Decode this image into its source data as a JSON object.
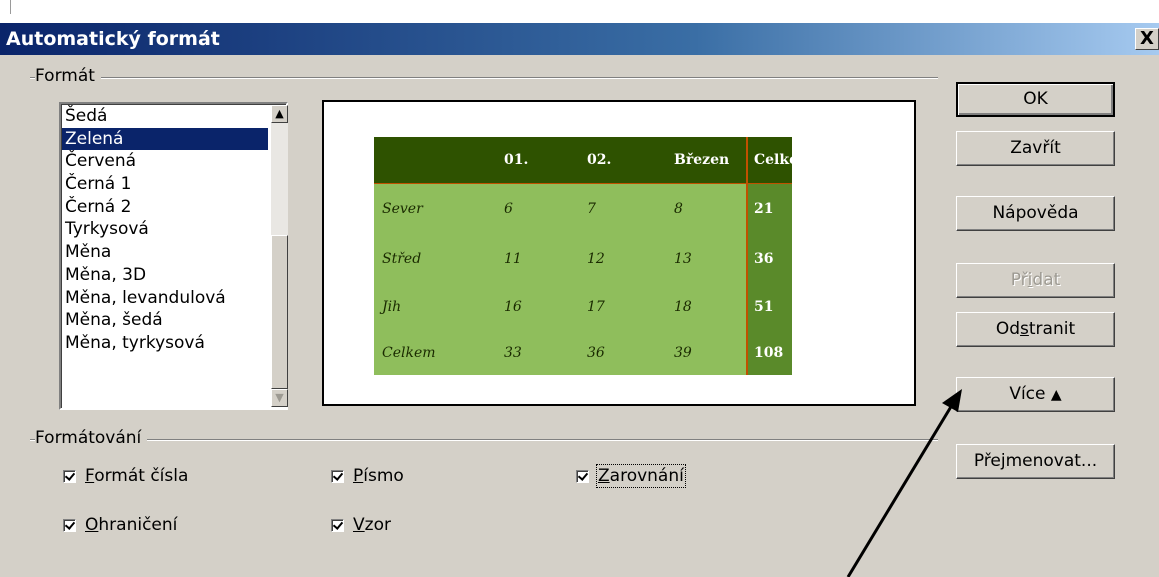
{
  "dialog": {
    "title": "Automatický formát",
    "close_glyph": "X"
  },
  "format_group": {
    "label": "Formát",
    "items": [
      "Šedá",
      "Zelená",
      "Červená",
      "Černá 1",
      "Černá 2",
      "Tyrkysová",
      "Měna",
      "Měna, 3D",
      "Měna, levandulová",
      "Měna, šedá",
      "Měna, tyrkysová"
    ],
    "selected_index": 1
  },
  "preview": {
    "header": [
      "",
      "01.",
      "02.",
      "Březen",
      "Celkem"
    ],
    "rows": [
      [
        "Sever",
        "6",
        "7",
        "8",
        "21"
      ],
      [
        "Střed",
        "11",
        "12",
        "13",
        "36"
      ],
      [
        "Jih",
        "16",
        "17",
        "18",
        "51"
      ],
      [
        "Celkem",
        "33",
        "36",
        "39",
        "108"
      ]
    ],
    "colors": {
      "header_bg": "#2e5200",
      "body_bg": "#8fbe5c",
      "total_col_bg": "#5a8a2a",
      "separator": "#c05000"
    }
  },
  "formatting_group": {
    "label": "Formátování",
    "options": {
      "number_format": {
        "label": "Formát čísla",
        "checked": true
      },
      "font": {
        "label": "Písmo",
        "checked": true
      },
      "alignment": {
        "label": "Zarovnání",
        "checked": true
      },
      "borders": {
        "label": "Ohraničení",
        "checked": true
      },
      "pattern": {
        "label": "Vzor",
        "checked": true
      }
    }
  },
  "buttons": {
    "ok": "OK",
    "close": "Zavřít",
    "help": "Nápověda",
    "add": "Přidat",
    "delete": "Odstranit",
    "more": "Více",
    "more_icon": "⯭",
    "rename": "Přejmenovat..."
  },
  "scroll": {
    "up_glyph": "▲",
    "down_glyph": "▼"
  }
}
